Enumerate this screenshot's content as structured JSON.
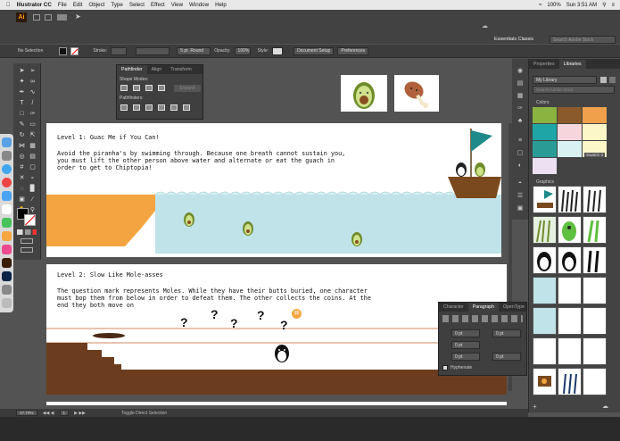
{
  "menubar": {
    "app": "Illustrator CC",
    "items": [
      "File",
      "Edit",
      "Object",
      "Type",
      "Select",
      "Effect",
      "View",
      "Window",
      "Help"
    ],
    "battery": "100%",
    "clock": "Sun 3:51 AM"
  },
  "appbar": {
    "workspace": "Essentials Classic",
    "search_placeholder": "Search Adobe Stock"
  },
  "control": {
    "selection": "No Selection",
    "stroke_label": "Stroke:",
    "brush": "5 pt. Round",
    "opacity_label": "Opacity:",
    "opacity": "100%",
    "style_label": "Style:",
    "doc_setup": "Document Setup",
    "preferences": "Preferences"
  },
  "pathfinder": {
    "tabs": [
      "Pathfinder",
      "Align",
      "Transform"
    ],
    "shape_modes": "Shape Modes:",
    "pathfinders": "Pathfinders:",
    "expand": "Expand"
  },
  "level1": {
    "title": "Level 1: Guac Me if You Can!",
    "body": "Avoid the piranha's by swimming through. Because one breath cannot sustain you, you must lift the other person above water and alternate or eat the guach in order to get to Chiptopia!"
  },
  "level2": {
    "title": "Level 2: Slow Like Mole-asses",
    "body": "The question mark represents Moles. While they have their butts buried, one character must bop them from below in order to defeat them. The other collects the coins. At the end they both move on",
    "marks": [
      "?",
      "?",
      "?",
      "?",
      "?"
    ],
    "coin": "$$"
  },
  "paragraph": {
    "tabs": [
      "Character",
      "Paragraph",
      "OpenType"
    ],
    "val1": "0 pt",
    "val2": "0 pt",
    "val3": "0 pt",
    "val4": "0 pt",
    "val5": "0 pt",
    "hyphenate": "Hyphenate"
  },
  "libraries": {
    "tabs": [
      "Properties",
      "Libraries"
    ],
    "library": "My Library",
    "search_placeholder": "Search Adobe Stock",
    "colors_label": "Colors",
    "graphics_label": "Graphics",
    "swatch_tooltip": "Swatch 3",
    "colors": [
      "#8ab33f",
      "#8b5a2b",
      "#f0a04b",
      "#1fa5a5",
      "#f6d6dc",
      "#fbf7c8",
      "#2a9c95",
      "#d9f1f3",
      "#fbf7c8",
      "#ece0f2"
    ]
  },
  "status": {
    "zoom": "17.74%",
    "page": "1",
    "tool": "Toggle Direct Selection"
  }
}
